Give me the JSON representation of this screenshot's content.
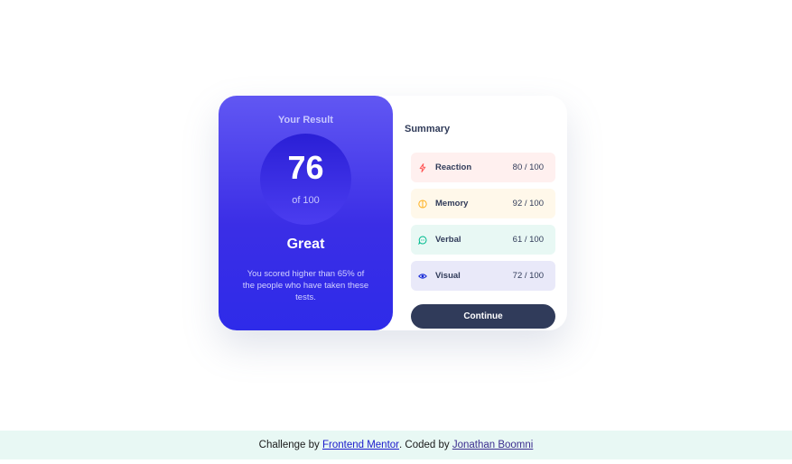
{
  "result": {
    "title": "Your Result",
    "score": "76",
    "of_total": "of 100",
    "rating": "Great",
    "description": "You scored higher than 65% of the people who have taken these tests."
  },
  "summary": {
    "title": "Summary",
    "items": [
      {
        "label": "Reaction",
        "score": "80 / 100",
        "icon": "lightning-icon",
        "color": "#ff5757"
      },
      {
        "label": "Memory",
        "score": "92 / 100",
        "icon": "brain-icon",
        "color": "#ffb01f"
      },
      {
        "label": "Verbal",
        "score": "61 / 100",
        "icon": "chat-bubble-icon",
        "color": "#00bb8f"
      },
      {
        "label": "Visual",
        "score": "72 / 100",
        "icon": "eye-icon",
        "color": "#1125d6"
      }
    ],
    "continue_label": "Continue"
  },
  "footer": {
    "prefix": "Challenge by",
    "mentor_link": "Frontend Mentor",
    "middle": ". Coded by",
    "author_link": "Jonathan Boomni"
  }
}
